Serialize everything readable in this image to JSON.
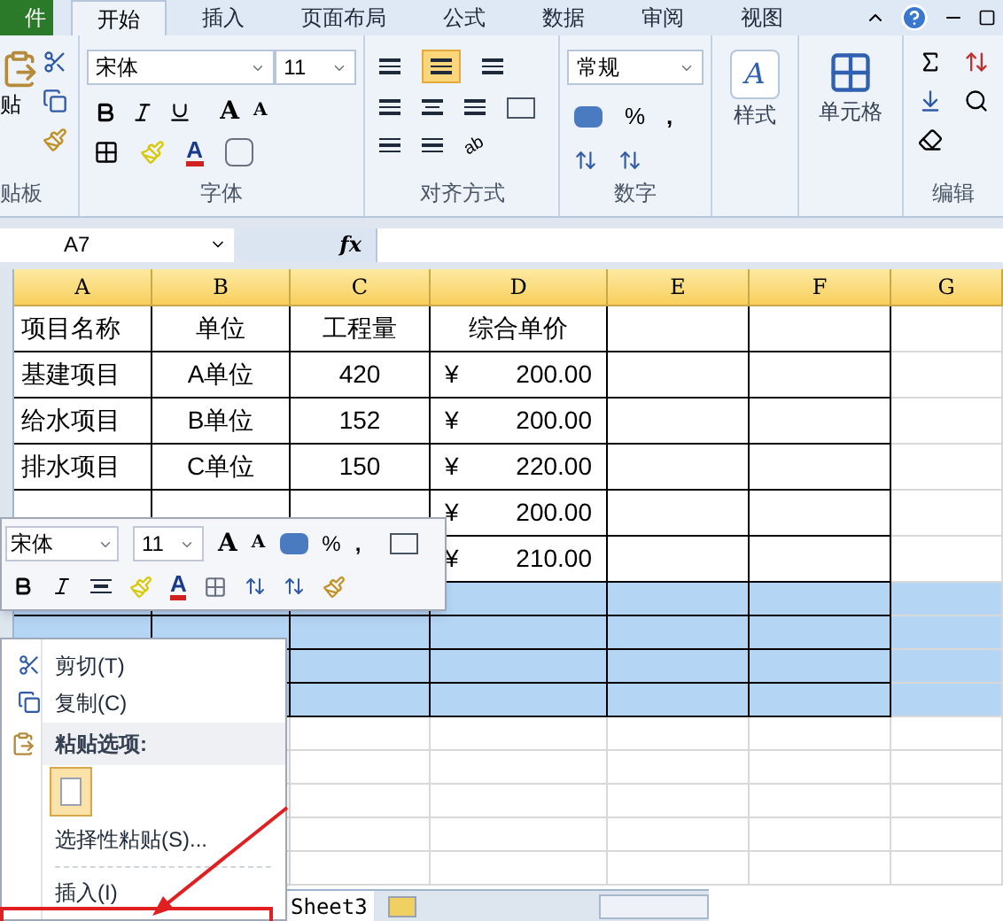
{
  "ribbon": {
    "tabs": [
      {
        "label": "件",
        "kind": "file",
        "selected": false
      },
      {
        "label": "开始",
        "kind": "tab",
        "selected": true
      },
      {
        "label": "插入",
        "kind": "tab",
        "selected": false
      },
      {
        "label": "页面布局",
        "kind": "tab",
        "selected": false
      },
      {
        "label": "公式",
        "kind": "tab",
        "selected": false
      },
      {
        "label": "数据",
        "kind": "tab",
        "selected": false
      },
      {
        "label": "审阅",
        "kind": "tab",
        "selected": false
      },
      {
        "label": "视图",
        "kind": "tab",
        "selected": false
      }
    ],
    "grow_font": "A",
    "shrink_font": "A",
    "font_color": "A",
    "orientation": "ab",
    "styles_glyph": "A",
    "paste_label": "贴",
    "clipboard_label": "贴板",
    "font_name": "宋体",
    "font_size": "11",
    "font_label": "字体",
    "align_label": "对齐方式",
    "number_format": "常规",
    "number_label": "数字",
    "percent": "%",
    "comma": ",",
    "styles_label": "样式",
    "cells_label": "单元格",
    "editing_label": "编辑",
    "center_aligned": true
  },
  "formula_bar": {
    "name_box": "A7",
    "fx": "fx"
  },
  "sheet": {
    "columns": [
      "A",
      "B",
      "C",
      "D",
      "E",
      "F",
      "G"
    ],
    "rows": [
      {
        "selected": false,
        "cells": [
          "项目名称",
          "单位",
          "工程量"
        ],
        "header": "综合单价"
      },
      {
        "selected": false,
        "cells": [
          "基建项目",
          "A单位",
          "420"
        ],
        "price": {
          "currency": "¥",
          "amount": "200.00"
        }
      },
      {
        "selected": false,
        "cells": [
          "给水项目",
          "B单位",
          "152"
        ],
        "price": {
          "currency": "¥",
          "amount": "200.00"
        }
      },
      {
        "selected": false,
        "cells": [
          "排水项目",
          "C单位",
          "150"
        ],
        "price": {
          "currency": "¥",
          "amount": "220.00"
        }
      },
      {
        "selected": false,
        "price": {
          "currency": "¥",
          "amount": "200.00"
        }
      },
      {
        "selected": false,
        "price": {
          "currency": "¥",
          "amount": "210.00"
        }
      },
      {
        "selected": true
      },
      {
        "selected": true
      },
      {
        "selected": true
      },
      {
        "selected": true
      },
      {
        "selected": false
      },
      {
        "selected": false
      },
      {
        "selected": false
      },
      {
        "selected": false
      },
      {
        "selected": false
      }
    ],
    "sheet_tab": "Sheet3"
  },
  "mini_toolbar": {
    "font_name": "宋体",
    "font_size": "11",
    "grow_font": "A",
    "shrink_font": "A",
    "font_color": "A",
    "percent": "%",
    "comma": ","
  },
  "context_menu": {
    "items": [
      {
        "kind": "cut",
        "label": "剪切(T)"
      },
      {
        "kind": "copy",
        "label": "复制(C)"
      },
      {
        "kind": "heading",
        "label": "粘贴选项:"
      },
      {
        "kind": "paste-option"
      },
      {
        "kind": "command",
        "label": "选择性粘贴(S)..."
      },
      {
        "kind": "separator"
      },
      {
        "kind": "command",
        "label": "插入(I)"
      }
    ]
  }
}
